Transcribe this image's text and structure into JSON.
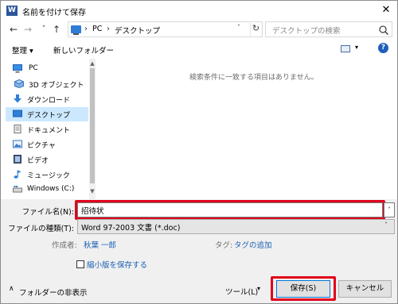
{
  "window": {
    "title": "名前を付けて保存",
    "app_icon_letter": "W",
    "close_glyph": "✕"
  },
  "navigation": {
    "back_glyph": "←",
    "forward_glyph": "→",
    "recent_glyph": "˅",
    "up_glyph": "↑",
    "address_parts": [
      "PC",
      "デスクトップ"
    ],
    "address_sep": "›",
    "refresh_glyph": "↻",
    "dropdown_glyph": "˅",
    "search_placeholder": "デスクトップの検索"
  },
  "toolbar": {
    "organize_label": "整理 ▾",
    "new_folder_label": "新しいフォルダー",
    "view_drop_glyph": "▾",
    "help_glyph": "?"
  },
  "nav_pane": {
    "items": [
      {
        "label": "PC",
        "icon": "computer-icon"
      },
      {
        "label": "3D オブジェクト",
        "icon": "3d-objects-icon"
      },
      {
        "label": "ダウンロード",
        "icon": "download-icon"
      },
      {
        "label": "デスクトップ",
        "icon": "desktop-icon",
        "selected": true
      },
      {
        "label": "ドキュメント",
        "icon": "document-icon"
      },
      {
        "label": "ピクチャ",
        "icon": "pictures-icon"
      },
      {
        "label": "ビデオ",
        "icon": "video-icon"
      },
      {
        "label": "ミュージック",
        "icon": "music-icon"
      },
      {
        "label": "Windows (C:)",
        "icon": "drive-icon"
      }
    ],
    "scroll_up": "▲",
    "scroll_down": "▼"
  },
  "content": {
    "empty_message": "検索条件に一致する項目はありません。"
  },
  "form": {
    "filename_label": "ファイル名(N):",
    "filename_value": "招待状",
    "filename_drop": "˅",
    "filetype_label": "ファイルの種類(T):",
    "filetype_value": "Word 97-2003 文書 (*.doc)",
    "filetype_drop": "˅",
    "author_label": "作成者:",
    "author_value": "秋葉 一郎",
    "tags_label": "タグ:",
    "tags_value": "タグの追加",
    "thumbnail_label": "縮小版を保存する"
  },
  "footer": {
    "hide_folders_chevron": "∧",
    "hide_folders_label": "フォルダーの非表示",
    "tools_label": "ツール(L)",
    "tools_drop": "▾",
    "save_label": "保存(S)",
    "cancel_label": "キャンセル"
  },
  "colors": {
    "highlight_red": "#e0001b",
    "selected_bg": "#cce8ff",
    "link_blue": "#1a5fb4",
    "primary_border": "#0078d7"
  }
}
